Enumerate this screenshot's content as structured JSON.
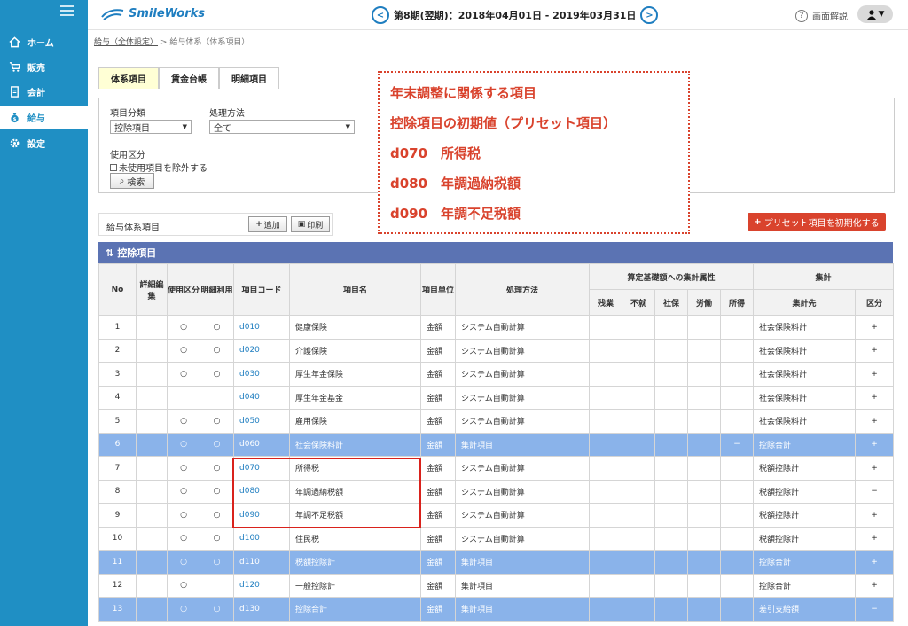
{
  "sidebar": {
    "items": [
      {
        "label": "ホーム",
        "icon": "home-icon"
      },
      {
        "label": "販売",
        "icon": "cart-icon"
      },
      {
        "label": "会計",
        "icon": "ledger-icon"
      },
      {
        "label": "給与",
        "icon": "money-bag-icon",
        "active": true
      },
      {
        "label": "設定",
        "icon": "gear-icon"
      }
    ]
  },
  "header": {
    "logo": "SmileWorks",
    "period": "第8期(翌期)：2018年04月01日 - 2019年03月31日",
    "help": "画面解説"
  },
  "breadcrumb": {
    "link": "給与（全体設定）",
    "sep": ">",
    "rest": "給与体系（体系項目）"
  },
  "tabs": [
    "体系項目",
    "賃金台帳",
    "明細項目"
  ],
  "filter": {
    "category_label": "項目分類",
    "category_value": "控除項目",
    "method_label": "処理方法",
    "method_value": "全て",
    "usage_label": "使用区分",
    "exclude_label": "未使用項目を除外する",
    "search": "検索"
  },
  "toolbar": {
    "title": "給与体系項目",
    "add": "追加",
    "print": "印刷",
    "reset": "プリセット項目を初期化する"
  },
  "callout": {
    "lines": [
      "年末調整に関係する項目",
      "控除項目の初期値（プリセット項目）",
      "d070　所得税",
      "d080　年調過納税額",
      "d090　年調不足税額"
    ]
  },
  "table": {
    "section": "控除項目",
    "headers": {
      "no": "No",
      "detail_edit": "詳細編集",
      "usage": "使用区分",
      "detail_use": "明細利用",
      "code": "項目コード",
      "name": "項目名",
      "unit": "項目単位",
      "method": "処理方法",
      "calc_group": "算定基礎額への集計属性",
      "calc": [
        "残業",
        "不就",
        "社保",
        "労働",
        "所得"
      ],
      "total_group": "集計",
      "total_target": "集計先",
      "total_kind": "区分"
    },
    "rows": [
      {
        "no": "1",
        "use": "○",
        "detail": "○",
        "code": "d010",
        "name": "健康保険",
        "unit": "金額",
        "method": "システム自動計算",
        "shotoku": "",
        "target": "社会保険料計",
        "kind": "+",
        "hl": false
      },
      {
        "no": "2",
        "use": "○",
        "detail": "○",
        "code": "d020",
        "name": "介護保険",
        "unit": "金額",
        "method": "システム自動計算",
        "shotoku": "",
        "target": "社会保険料計",
        "kind": "+",
        "hl": false
      },
      {
        "no": "3",
        "use": "○",
        "detail": "○",
        "code": "d030",
        "name": "厚生年金保険",
        "unit": "金額",
        "method": "システム自動計算",
        "shotoku": "",
        "target": "社会保険料計",
        "kind": "+",
        "hl": false
      },
      {
        "no": "4",
        "use": "",
        "detail": "",
        "code": "d040",
        "name": "厚生年金基金",
        "unit": "金額",
        "method": "システム自動計算",
        "shotoku": "",
        "target": "社会保険料計",
        "kind": "+",
        "hl": false
      },
      {
        "no": "5",
        "use": "○",
        "detail": "○",
        "code": "d050",
        "name": "雇用保険",
        "unit": "金額",
        "method": "システム自動計算",
        "shotoku": "",
        "target": "社会保険料計",
        "kind": "+",
        "hl": false
      },
      {
        "no": "6",
        "use": "○",
        "detail": "○",
        "code": "d060",
        "name": "社会保険料計",
        "unit": "金額",
        "method": "集計項目",
        "shotoku": "−",
        "target": "控除合計",
        "kind": "+",
        "hl": true
      },
      {
        "no": "7",
        "use": "○",
        "detail": "○",
        "code": "d070",
        "name": "所得税",
        "unit": "金額",
        "method": "システム自動計算",
        "shotoku": "",
        "target": "税額控除計",
        "kind": "+",
        "hl": false
      },
      {
        "no": "8",
        "use": "○",
        "detail": "○",
        "code": "d080",
        "name": "年調過納税額",
        "unit": "金額",
        "method": "システム自動計算",
        "shotoku": "",
        "target": "税額控除計",
        "kind": "−",
        "hl": false
      },
      {
        "no": "9",
        "use": "○",
        "detail": "○",
        "code": "d090",
        "name": "年調不足税額",
        "unit": "金額",
        "method": "システム自動計算",
        "shotoku": "",
        "target": "税額控除計",
        "kind": "+",
        "hl": false
      },
      {
        "no": "10",
        "use": "○",
        "detail": "○",
        "code": "d100",
        "name": "住民税",
        "unit": "金額",
        "method": "システム自動計算",
        "shotoku": "",
        "target": "税額控除計",
        "kind": "+",
        "hl": false
      },
      {
        "no": "11",
        "use": "○",
        "detail": "○",
        "code": "d110",
        "name": "税額控除計",
        "unit": "金額",
        "method": "集計項目",
        "shotoku": "",
        "target": "控除合計",
        "kind": "+",
        "hl": true
      },
      {
        "no": "12",
        "use": "○",
        "detail": "",
        "code": "d120",
        "name": "一般控除計",
        "unit": "金額",
        "method": "集計項目",
        "shotoku": "",
        "target": "控除合計",
        "kind": "+",
        "hl": false
      },
      {
        "no": "13",
        "use": "○",
        "detail": "○",
        "code": "d130",
        "name": "控除合計",
        "unit": "金額",
        "method": "集計項目",
        "shotoku": "",
        "target": "差引支給額",
        "kind": "−",
        "hl": true
      }
    ]
  }
}
